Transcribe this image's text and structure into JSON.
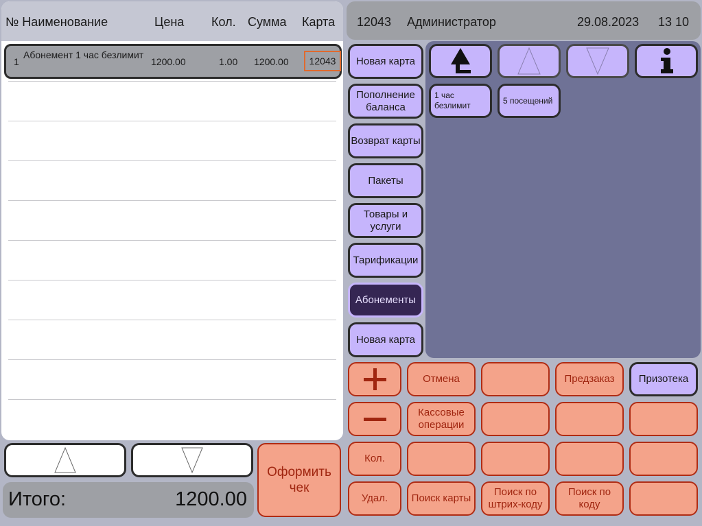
{
  "order_table": {
    "headers": {
      "name": "№ Наименование",
      "price": "Цена",
      "qty": "Кол.",
      "sum": "Сумма",
      "card": "Карта"
    },
    "rows": [
      {
        "no": "1",
        "name": "Абонемент 1 час безлимит",
        "price": "1200.00",
        "qty": "1.00",
        "sum": "1200.00",
        "card": "12043"
      }
    ]
  },
  "total": {
    "label": "Итого:",
    "value": "1200.00"
  },
  "checkout_label": "Оформить чек",
  "top_bar": {
    "card_number": "12043",
    "user": "Администратор",
    "date": "29.08.2023",
    "time": "13 10"
  },
  "menu": [
    "Новая карта",
    "Пополнение баланса",
    "Возврат карты",
    "Пакеты",
    "Товары и услуги",
    "Тарификации",
    "Абонементы",
    "Новая карта"
  ],
  "active_menu": "Абонементы",
  "products": [
    "1 час безлимит",
    "5 посещений"
  ],
  "keypad": {
    "plus_icon": "plus-icon",
    "minus_icon": "minus-icon",
    "qty": "Кол.",
    "delete": "Удал.",
    "cancel": "Отмена",
    "cash_ops": "Кассовые операции",
    "search_card": "Поиск карты",
    "preorder": "Предзаказ",
    "search_barcode": "Поиск по штрих-коду",
    "search_code": "Поиск по коду",
    "prizoteka": "Призотека"
  },
  "colors": {
    "menu_button": "#c6b5fc",
    "menu_active": "#352653",
    "key_fill": "#f4a38a",
    "key_border": "#b02c14",
    "card_highlight": "#e06a2e",
    "products_bg": "#6f7296"
  }
}
